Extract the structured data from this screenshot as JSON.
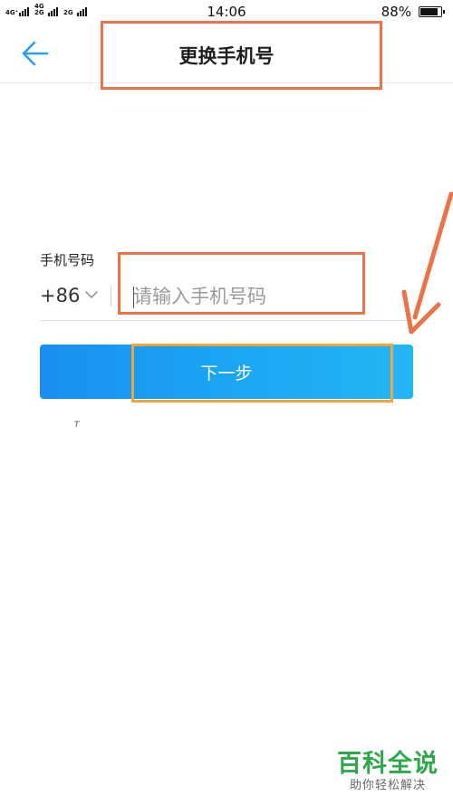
{
  "status_bar": {
    "signal_1_label": "4G⁺",
    "signal_2_label": "4G 2G",
    "signal_3_label": "2G",
    "time": "14:06",
    "battery_percent": "88%",
    "battery_level": 0.88
  },
  "nav": {
    "title": "更换手机号",
    "back_icon": "arrow-left-icon"
  },
  "form": {
    "phone_label": "手机号码",
    "country_code": "+86",
    "phone_placeholder": "请输入手机号码",
    "phone_value": "",
    "next_button_label": "下一步",
    "tiny_mark": "T"
  },
  "watermark": {
    "main": "百科全说",
    "sub": "助你轻松解决"
  },
  "colors": {
    "accent_blue": "#1b9af2",
    "annotation_orange": "#e87448",
    "annotation_yellow": "#f2a53c",
    "watermark_green": "#2ea84a"
  }
}
